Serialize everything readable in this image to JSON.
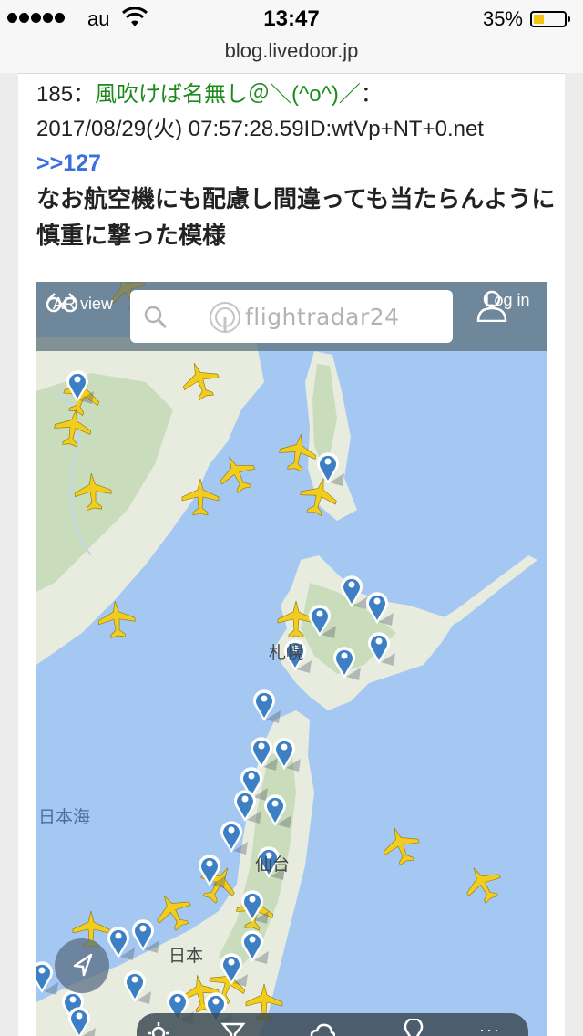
{
  "status_bar": {
    "carrier": "au",
    "time": "13:47",
    "battery_percent_text": "35%",
    "battery_level": 0.35,
    "signal_bars": 5,
    "colors": {
      "battery_fill": "#f2c40f"
    }
  },
  "browser": {
    "url": "blog.livedoor.jp"
  },
  "post": {
    "number": "185",
    "separator": "：",
    "author": "風吹けば名無し＠＼(^o^)／",
    "trailing": "：",
    "datetime_id": "2017/08/29(火) 07:57:28.59ID:wtVp+NT+0.net",
    "anchor": ">>127",
    "body": "なお航空機にも配慮し間違っても当たらんように慎重に撃った模様",
    "colors": {
      "author": "#1e8a1e",
      "anchor": "#3a6fdd"
    }
  },
  "flightradar": {
    "ar_view_label": "AR view",
    "logo_text": "flightradar24",
    "login_label": "Log in",
    "map_labels": {
      "sapporo": "札幌",
      "sea_of_japan": "日本海",
      "japan": "日本",
      "sendai": "仙台"
    },
    "colors": {
      "sea": "#a5c8f3",
      "land": "#e7ecdf",
      "forest": "#c9dcbc",
      "plane": "#f2cd1d",
      "pin": "#3d7fc4"
    },
    "icons": [
      "binoculars-icon",
      "search-icon",
      "radar-logo-icon",
      "user-icon",
      "location-arrow-icon",
      "plane-icon",
      "pin-icon",
      "settings-icon",
      "filter-icon",
      "weather-icon"
    ],
    "bottom_more": "···"
  }
}
